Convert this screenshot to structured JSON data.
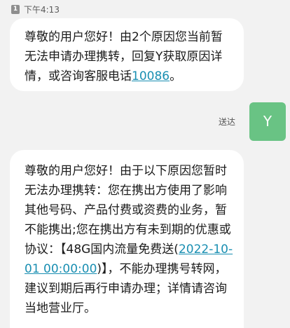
{
  "status": {
    "sim": "1",
    "time": "下午4:13"
  },
  "msg1": {
    "part1": "尊敬的用户您好！由2个原因您当前暂无法申请办理携转，回复Y获取原因详情，或咨询客服电话",
    "phone": "10086",
    "part2": "。"
  },
  "reply": {
    "status": "送达",
    "avatar_text": "Y"
  },
  "msg2": {
    "part1": "尊敬的用户您好！由于以下原因您暂时无法办理携转：您在携出方使用了影响其他号码、产品付费或资费的业务，暂不能携出;您在携出方有未到期的优惠或协议：【48G国内流量免费送(",
    "date": "2022-10-01 00:00:00",
    "part2": ")】，不能办理携号转网，建议到期后再行申请办理；详情请咨询当地营业厅。"
  },
  "colors": {
    "link": "#1a8fb2",
    "avatar": "#69c384",
    "background": "#f2f2f2"
  }
}
